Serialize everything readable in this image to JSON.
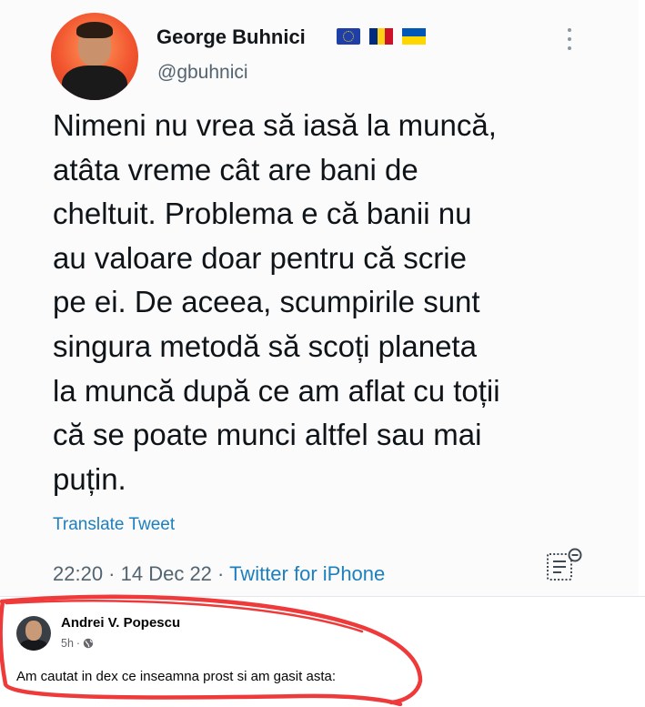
{
  "tweet": {
    "author_name": "George Buhnici",
    "handle": "@gbuhnici",
    "text": "Nimeni nu vrea să iasă la muncă,\natâta vreme cât are bani de\ncheltuit. Problema e că banii nu\nau valoare doar pentru că scrie\npe ei. De aceea, scumpirile sunt\nsingura metodă să scoți planeta\nla muncă după ce am aflat cu toții\ncă se poate munci altfel sau mai\npuțin.",
    "translate_label": "Translate Tweet",
    "time": "22:20",
    "separator": " · ",
    "date": "14 Dec 22",
    "source": "Twitter for iPhone",
    "flag_icons": [
      "eu-flag-icon",
      "romania-flag-icon",
      "ukraine-flag-icon"
    ],
    "colors": {
      "link": "#1d7fbf",
      "secondary_text": "#536471",
      "eu_blue": "#1f3fa8",
      "ro_blue": "#002b7f",
      "ro_yellow": "#fcd116",
      "ro_red": "#ce1126",
      "ua_blue": "#0057b7",
      "ua_yellow": "#ffd700"
    }
  },
  "facebook_post": {
    "author_name": "Andrei V. Popescu",
    "time": "5h",
    "separator": " · ",
    "audience_icon": "globe-icon",
    "text": "Am cautat in dex ce inseamna prost si am gasit asta:",
    "highlight_color": "#ee3a3a"
  }
}
